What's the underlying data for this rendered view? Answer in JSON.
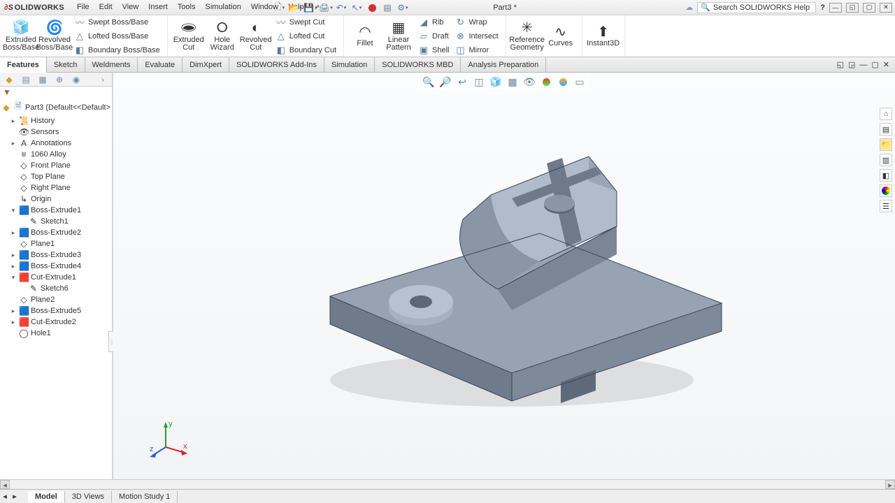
{
  "app": {
    "logo_prefix": "S",
    "logo_suffix": "OLID",
    "logo_works": "WORKS",
    "title": "Part3 *"
  },
  "menu": [
    "File",
    "Edit",
    "View",
    "Insert",
    "Tools",
    "Simulation",
    "Window",
    "Help"
  ],
  "search": {
    "placeholder": "Search SOLIDWORKS Help"
  },
  "ribbon": {
    "bossbase": {
      "extruded": "Extruded Boss/Base",
      "revolved": "Revolved Boss/Base",
      "swept": "Swept Boss/Base",
      "lofted": "Lofted Boss/Base",
      "boundary": "Boundary Boss/Base"
    },
    "cut": {
      "extruded": "Extruded Cut",
      "hole": "Hole Wizard",
      "revolved": "Revolved Cut",
      "swept": "Swept Cut",
      "lofted": "Lofted Cut",
      "boundary": "Boundary Cut"
    },
    "feat": {
      "fillet": "Fillet",
      "pattern": "Linear Pattern",
      "rib": "Rib",
      "draft": "Draft",
      "shell": "Shell",
      "wrap": "Wrap",
      "intersect": "Intersect",
      "mirror": "Mirror"
    },
    "ref": {
      "geom": "Reference Geometry",
      "curves": "Curves",
      "instant": "Instant3D"
    }
  },
  "tabs": [
    "Features",
    "Sketch",
    "Weldments",
    "Evaluate",
    "DimXpert",
    "SOLIDWORKS Add-Ins",
    "Simulation",
    "SOLIDWORKS MBD",
    "Analysis Preparation"
  ],
  "tree": {
    "root": "Part3  (Default<<Default>",
    "items": [
      {
        "t": "History",
        "tw": "▸",
        "ico": "📜"
      },
      {
        "t": "Sensors",
        "tw": "",
        "ico": "👁"
      },
      {
        "t": "Annotations",
        "tw": "▸",
        "ico": "A"
      },
      {
        "t": "1060 Alloy",
        "tw": "",
        "ico": "≡"
      },
      {
        "t": "Front Plane",
        "tw": "",
        "ico": "◇"
      },
      {
        "t": "Top Plane",
        "tw": "",
        "ico": "◇"
      },
      {
        "t": "Right Plane",
        "tw": "",
        "ico": "◇"
      },
      {
        "t": "Origin",
        "tw": "",
        "ico": "↳"
      },
      {
        "t": "Boss-Extrude1",
        "tw": "▾",
        "ico": "🟦",
        "sub": "Sketch1"
      },
      {
        "t": "Boss-Extrude2",
        "tw": "▸",
        "ico": "🟦"
      },
      {
        "t": "Plane1",
        "tw": "",
        "ico": "◇"
      },
      {
        "t": "Boss-Extrude3",
        "tw": "▸",
        "ico": "🟦"
      },
      {
        "t": "Boss-Extrude4",
        "tw": "▸",
        "ico": "🟦"
      },
      {
        "t": "Cut-Extrude1",
        "tw": "▾",
        "ico": "🟥",
        "sub": "Sketch6"
      },
      {
        "t": "Plane2",
        "tw": "",
        "ico": "◇"
      },
      {
        "t": "Boss-Extrude5",
        "tw": "▸",
        "ico": "🟦"
      },
      {
        "t": "Cut-Extrude2",
        "tw": "▸",
        "ico": "🟥"
      },
      {
        "t": "Hole1",
        "tw": "",
        "ico": "◯"
      }
    ]
  },
  "triad": {
    "x": "x",
    "y": "y",
    "z": "z"
  },
  "bottom_tabs": [
    "Model",
    "3D Views",
    "Motion Study 1"
  ]
}
